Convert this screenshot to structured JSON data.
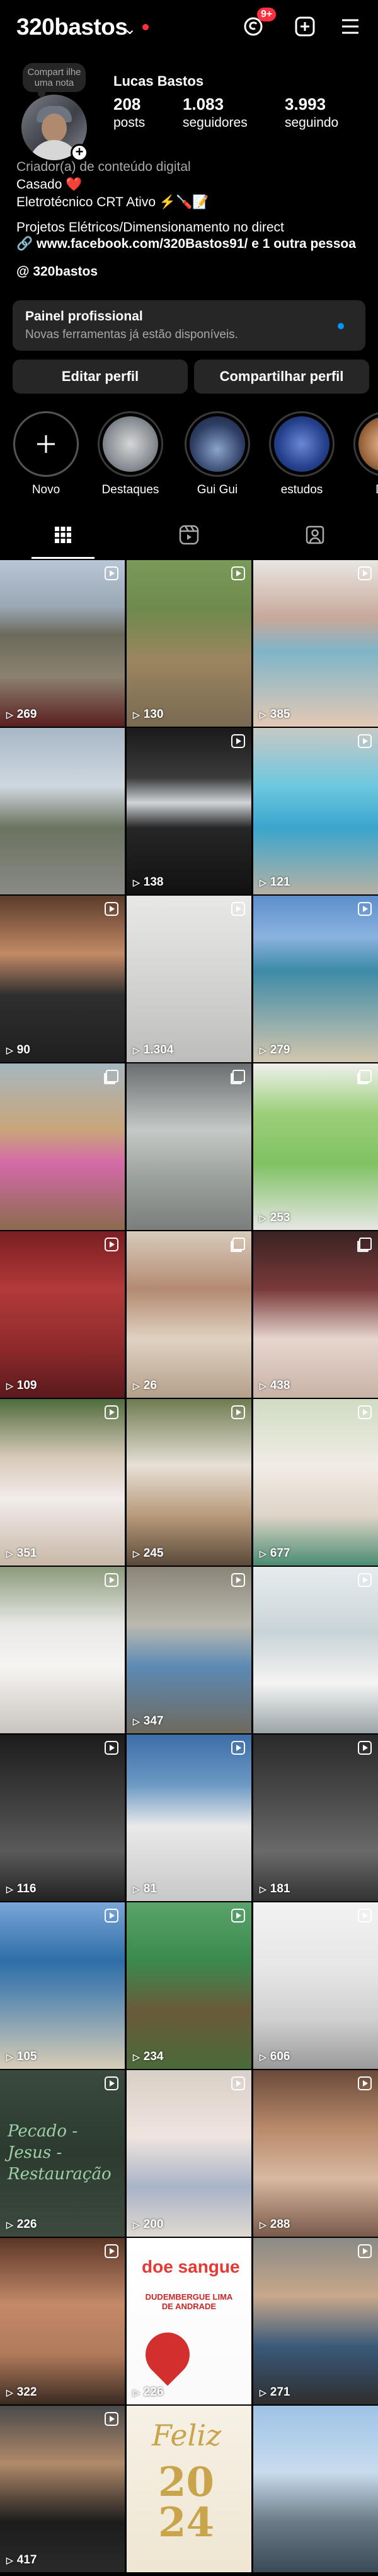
{
  "header": {
    "username": "320bastos",
    "notification_badge": "9+",
    "icons": [
      "threads-icon",
      "add-post-icon",
      "menu-icon"
    ]
  },
  "profile": {
    "note": "Compart ilhe uma nota",
    "full_name": "Lucas Bastos",
    "stats": [
      {
        "num": "208",
        "label": "posts"
      },
      {
        "num": "1.083",
        "label": "seguidores"
      },
      {
        "num": "3.993",
        "label": "seguindo"
      }
    ],
    "category": "Criador(a) de conteúdo digital",
    "bio_lines": [
      "Casado ❤️",
      "Eletrotécnico CRT Ativo ⚡🪛📝",
      "Projetos Elétricos/Dimensionamento no direct"
    ],
    "link": "www.facebook.com/320Bastos91/ e 1 outra pessoa",
    "threads_handle": "320bastos"
  },
  "pro_panel": {
    "title": "Painel profissional",
    "subtitle": "Novas ferramentas já estão disponíveis."
  },
  "buttons": {
    "edit": "Editar perfil",
    "share": "Compartilhar perfil"
  },
  "highlights": [
    "Novo",
    "Destaques",
    "Gui Gui",
    "estudos",
    "Des"
  ],
  "tabs": [
    "grid-icon",
    "reels-icon",
    "tagged-icon"
  ],
  "posts": [
    {
      "views": "269",
      "badge": "reel"
    },
    {
      "views": "130",
      "badge": "reel"
    },
    {
      "views": "385",
      "badge": "reel"
    },
    {
      "views": "",
      "badge": ""
    },
    {
      "views": "138",
      "badge": "reel"
    },
    {
      "views": "121",
      "badge": "reel"
    },
    {
      "views": "90",
      "badge": "reel"
    },
    {
      "views": "1.304",
      "badge": "reel"
    },
    {
      "views": "279",
      "badge": "reel"
    },
    {
      "views": "",
      "badge": "multi"
    },
    {
      "views": "",
      "badge": "multi"
    },
    {
      "views": "253",
      "badge": "multi"
    },
    {
      "views": "109",
      "badge": "reel"
    },
    {
      "views": "26",
      "badge": "multi"
    },
    {
      "views": "438",
      "badge": "multi"
    },
    {
      "views": "351",
      "badge": "reel"
    },
    {
      "views": "245",
      "badge": "reel"
    },
    {
      "views": "677",
      "badge": "reel"
    },
    {
      "views": "",
      "badge": "reel"
    },
    {
      "views": "347",
      "badge": "reel"
    },
    {
      "views": "",
      "badge": "reel"
    },
    {
      "views": "116",
      "badge": "reel"
    },
    {
      "views": "81",
      "badge": "reel"
    },
    {
      "views": "181",
      "badge": "reel"
    },
    {
      "views": "105",
      "badge": "reel"
    },
    {
      "views": "234",
      "badge": "reel"
    },
    {
      "views": "606",
      "badge": "reel"
    },
    {
      "views": "226",
      "badge": "reel"
    },
    {
      "views": "200",
      "badge": "reel"
    },
    {
      "views": "288",
      "badge": "reel"
    },
    {
      "views": "322",
      "badge": "reel"
    },
    {
      "views": "226",
      "badge": "reel"
    },
    {
      "views": "271",
      "badge": "reel"
    },
    {
      "views": "417",
      "badge": "reel"
    },
    {
      "views": "",
      "badge": ""
    },
    {
      "views": "",
      "badge": ""
    }
  ],
  "overlay_texts": {
    "p28": "Pecado - Jesus - Restauração",
    "p32_title": "doe sangue",
    "p32_sub": "DUDEMBERGUE LIMA DE ANDRADE",
    "p35_a": "Feliz",
    "p35_b": "2024"
  }
}
